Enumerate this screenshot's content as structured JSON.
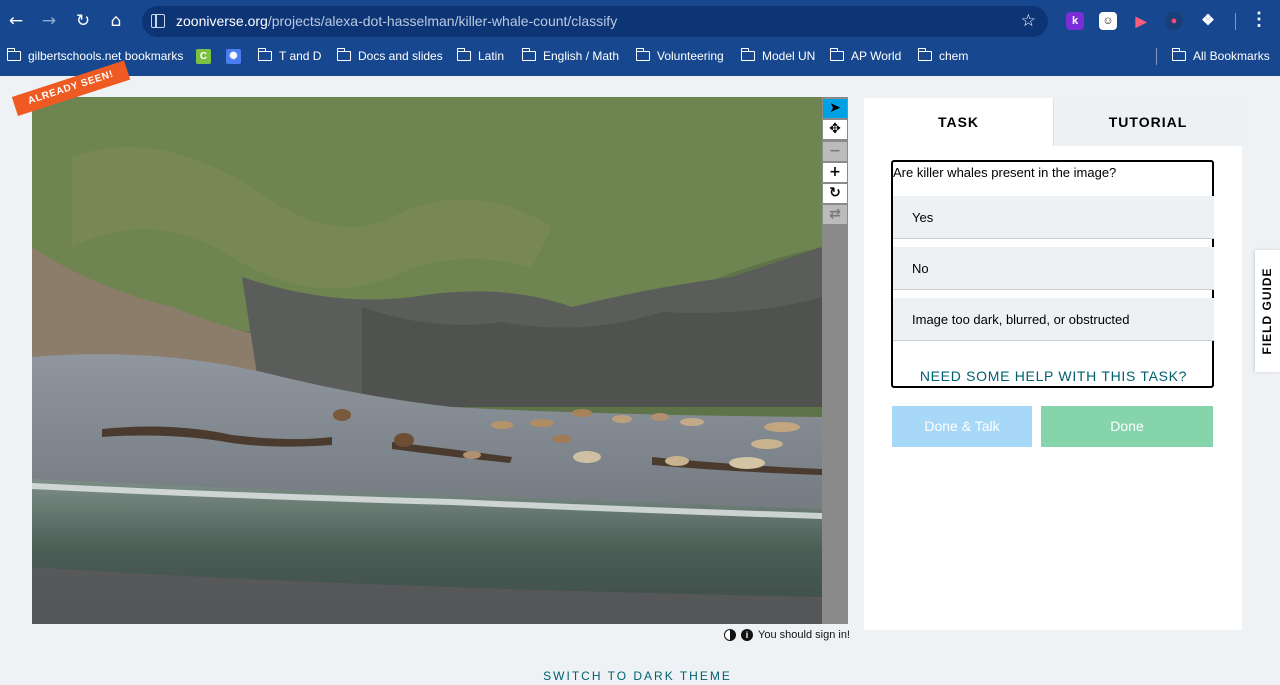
{
  "browser": {
    "url_host": "zooniverse.org",
    "url_path": "/projects/alexa-dot-hasselman/killer-whale-count/classify",
    "extensions": [
      {
        "name": "k-extension",
        "label": "k"
      },
      {
        "name": "avatar-extension",
        "label": "☺"
      },
      {
        "name": "record-extension",
        "label": "▶"
      },
      {
        "name": "circle-extension",
        "label": "●"
      },
      {
        "name": "puzzle-extension",
        "label": "❖"
      }
    ],
    "bookmarks": [
      {
        "label": "gilbertschools.net bookmarks"
      },
      {
        "label": "T and D"
      },
      {
        "label": "Docs and slides"
      },
      {
        "label": "Latin"
      },
      {
        "label": "English / Math"
      },
      {
        "label": "Volunteering"
      },
      {
        "label": "Model UN"
      },
      {
        "label": "AP World"
      },
      {
        "label": "chem"
      }
    ],
    "all_bookmarks": "All Bookmarks"
  },
  "subject": {
    "badge": "ALREADY SEEN!",
    "sign_in_note": "You should sign in!"
  },
  "tabs": {
    "task": "TASK",
    "tutorial": "TUTORIAL"
  },
  "task": {
    "question": "Are killer whales present in the image?",
    "answers": [
      "Yes",
      "No",
      "Image too dark, blurred, or obstructed"
    ],
    "help": "NEED SOME HELP WITH THIS TASK?",
    "done_talk": "Done & Talk",
    "done": "Done"
  },
  "field_guide": "FIELD GUIDE",
  "footer": {
    "dark_theme": "SWITCH TO DARK THEME"
  },
  "colors": {
    "browser_chrome": "#17488f",
    "badge": "#ef5a22",
    "active_tool": "#00a1e4",
    "done_talk": "#a7d8f7",
    "done": "#86d4ac",
    "link": "#00606e"
  },
  "icons": {
    "back": "arrow-left-icon",
    "forward": "arrow-right-icon",
    "reload": "reload-icon",
    "home": "home-icon",
    "star": "star-icon",
    "menu": "kebab-menu-icon",
    "folder": "folder-icon",
    "pointer": "cursor-pointer-icon",
    "move": "move-icon",
    "zoom_out": "minus-icon",
    "zoom_in": "plus-icon",
    "rotate": "rotate-icon",
    "reset": "reset-icon",
    "invert": "invert-icon",
    "info": "info-icon"
  }
}
